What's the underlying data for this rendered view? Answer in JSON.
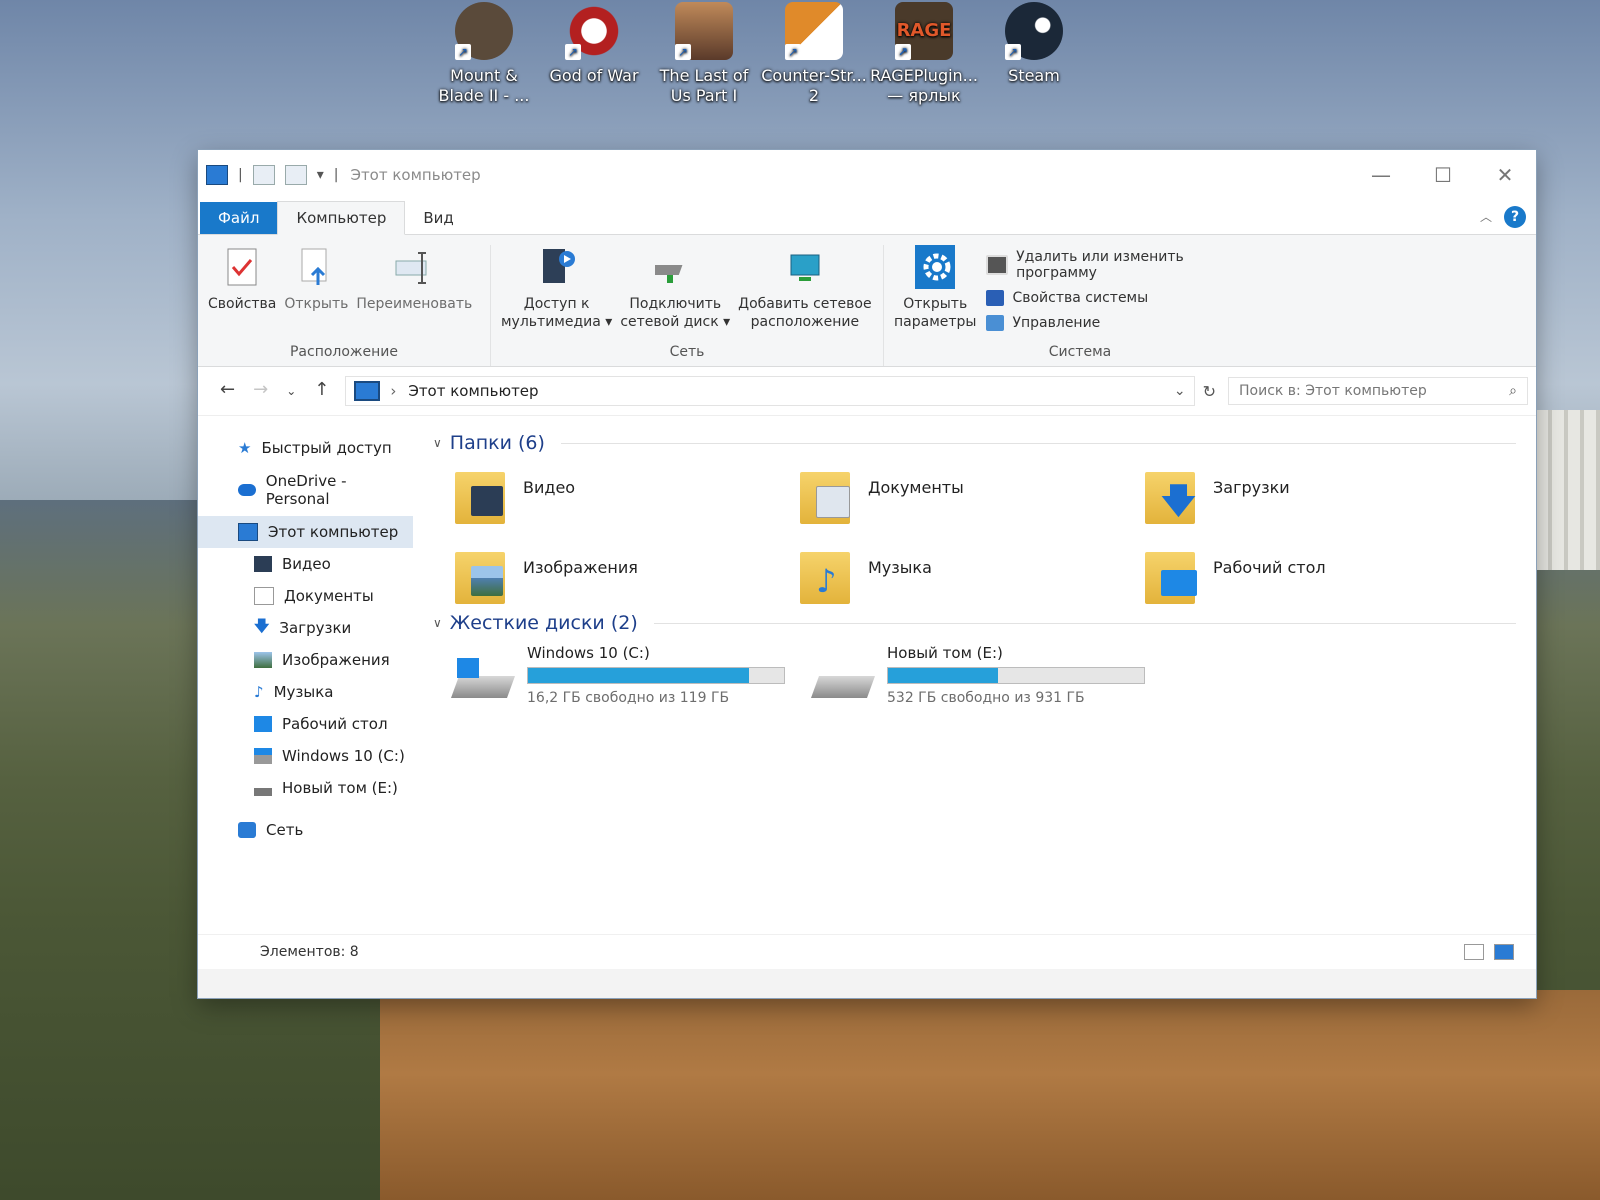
{
  "desktop": {
    "icons": [
      {
        "line1": "Mount &",
        "line2": "Blade II - ...",
        "color": "#5a4a3a"
      },
      {
        "line1": "God of War",
        "line2": "",
        "color": "#b32020"
      },
      {
        "line1": "The Last of",
        "line2": "Us Part I",
        "color": "#7a5a3a"
      },
      {
        "line1": "Counter-Str...",
        "line2": "2",
        "color": "#e08a2a"
      },
      {
        "line1": "RAGEPlugin...",
        "line2": "— ярлык",
        "color": "#4a3a2a"
      },
      {
        "line1": "Steam",
        "line2": "",
        "color": "#1b2838"
      }
    ]
  },
  "window": {
    "title": "Этот компьютер",
    "controls": {
      "minimize": "—",
      "maximize": "☐",
      "close": "✕"
    },
    "tabs": {
      "file": "Файл",
      "computer": "Компьютер",
      "view": "Вид"
    },
    "help": "?",
    "ribbon": {
      "location": {
        "label": "Расположение",
        "properties": "Свойства",
        "open": "Открыть",
        "rename": "Переименовать"
      },
      "network": {
        "label": "Сеть",
        "media_line1": "Доступ к",
        "media_line2": "мультимедиа ▾",
        "map_line1": "Подключить",
        "map_line2": "сетевой диск ▾",
        "add_line1": "Добавить сетевое",
        "add_line2": "расположение"
      },
      "system": {
        "label": "Система",
        "open_line1": "Открыть",
        "open_line2": "параметры",
        "uninstall": "Удалить или изменить программу",
        "sysprops": "Свойства системы",
        "manage": "Управление"
      }
    },
    "address": {
      "path": "Этот компьютер",
      "search_placeholder": "Поиск в: Этот компьютер"
    },
    "sidebar": {
      "quick": "Быстрый доступ",
      "onedrive": "OneDrive - Personal",
      "thispc": "Этот компьютер",
      "items": [
        "Видео",
        "Документы",
        "Загрузки",
        "Изображения",
        "Музыка",
        "Рабочий стол",
        "Windows 10 (C:)",
        "Новый том (E:)"
      ],
      "network": "Сеть"
    },
    "folders_section": "Папки (6)",
    "folders": [
      {
        "name": "Видео",
        "badge": "#2b3d55"
      },
      {
        "name": "Документы",
        "badge": "#dfe6ee"
      },
      {
        "name": "Загрузки",
        "badge": "#1b6fd1"
      },
      {
        "name": "Изображения",
        "badge": "#4f7fb0"
      },
      {
        "name": "Музыка",
        "badge": "#2a7bd4"
      },
      {
        "name": "Рабочий стол",
        "badge": "#1e88e5"
      }
    ],
    "drives_section": "Жесткие диски (2)",
    "drives": [
      {
        "name": "Windows 10 (C:)",
        "free": "16,2 ГБ свободно из 119 ГБ",
        "used_fraction": 0.864
      },
      {
        "name": "Новый том (E:)",
        "free": "532 ГБ свободно из 931 ГБ",
        "used_fraction": 0.429
      }
    ],
    "status": "Элементов: 8"
  }
}
